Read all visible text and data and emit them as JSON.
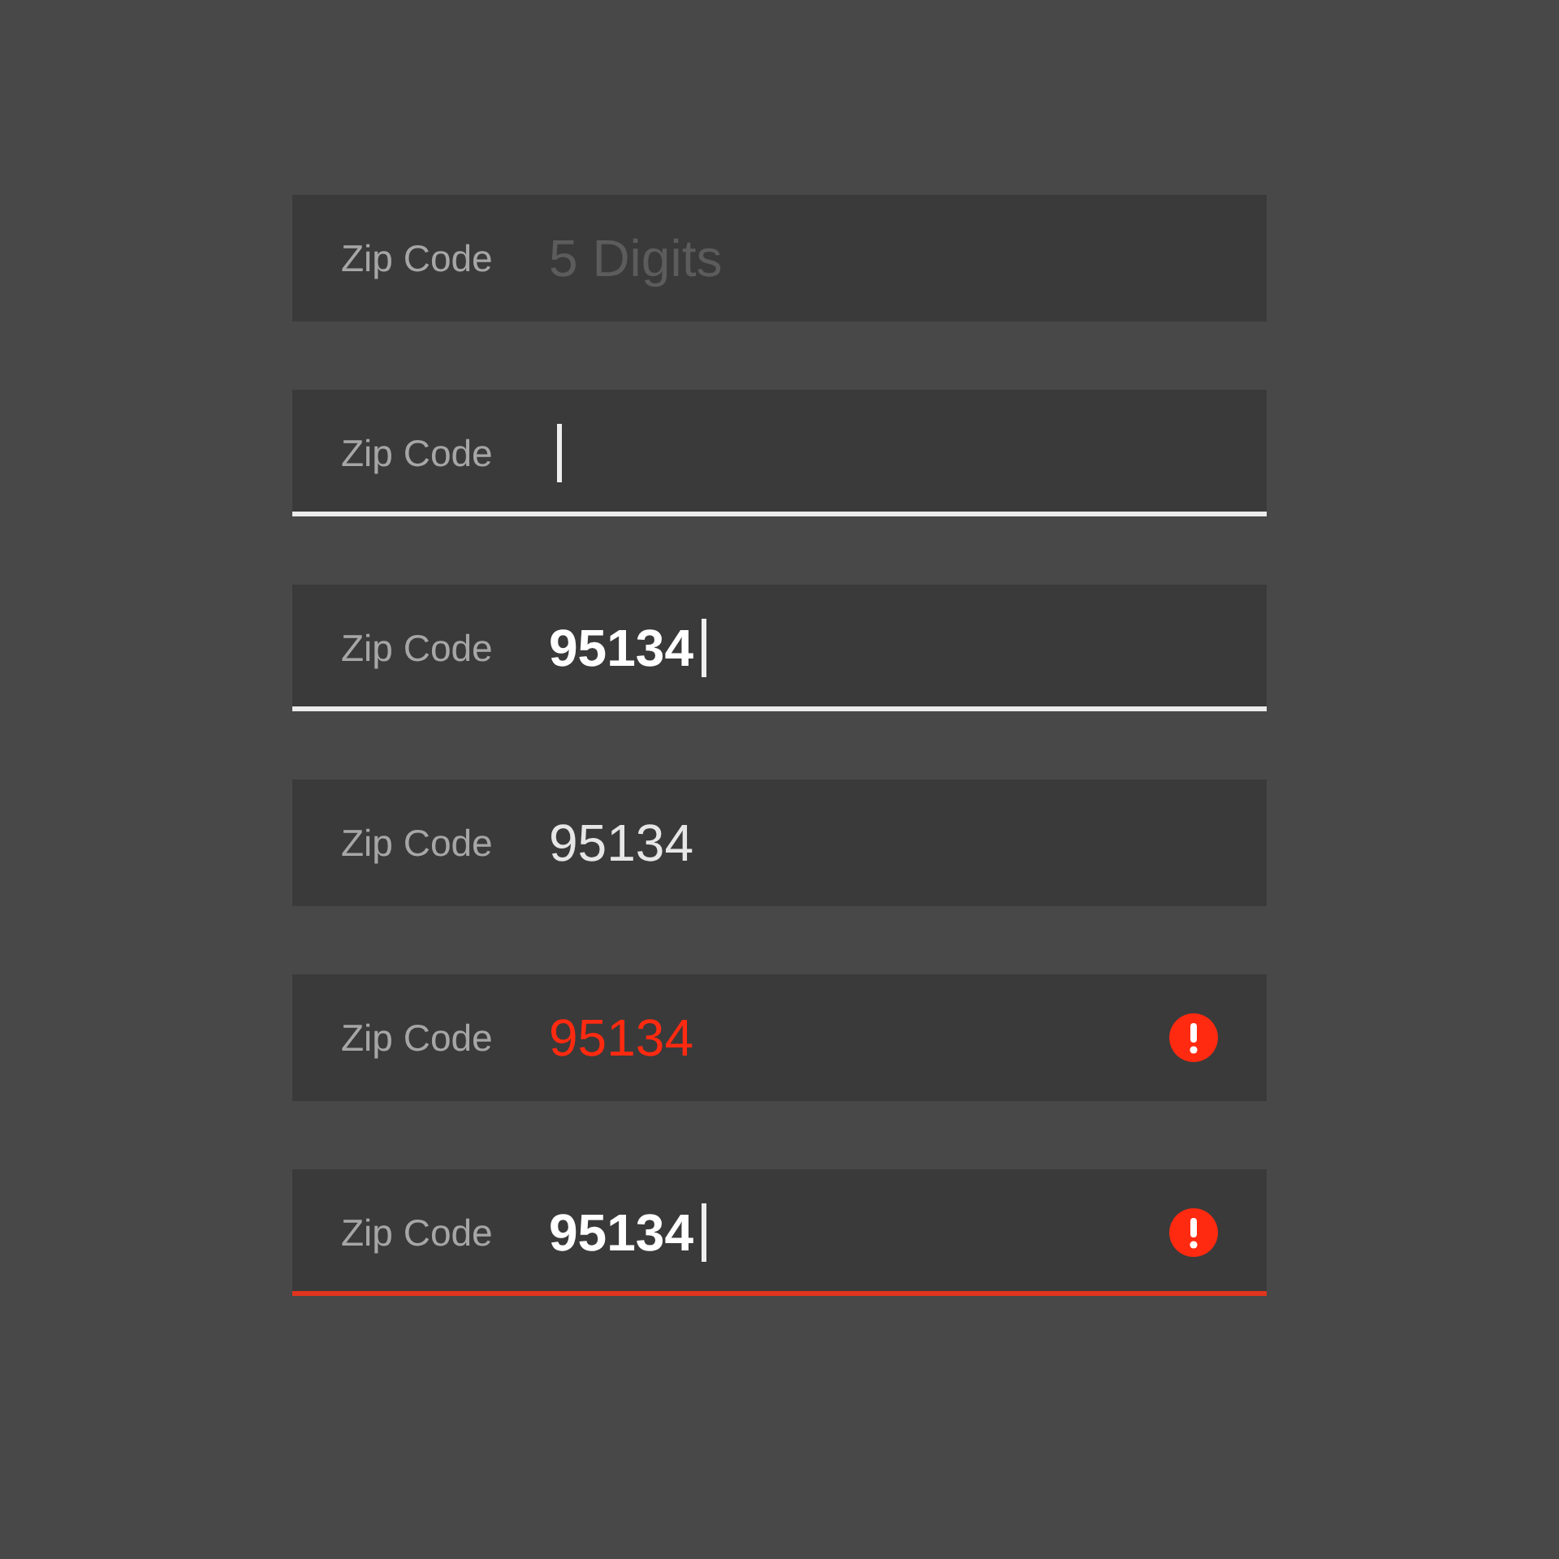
{
  "fields": [
    {
      "label": "Zip Code",
      "placeholder": "5 Digits",
      "focused": false,
      "error": false
    },
    {
      "label": "Zip Code",
      "focused": true,
      "error": false
    },
    {
      "label": "Zip Code",
      "value": "95134",
      "focused": true,
      "error": false
    },
    {
      "label": "Zip Code",
      "value": "95134",
      "focused": false,
      "error": false
    },
    {
      "label": "Zip Code",
      "value": "95134",
      "focused": false,
      "error": true
    },
    {
      "label": "Zip Code",
      "value": "95134",
      "focused": true,
      "error": true
    }
  ]
}
